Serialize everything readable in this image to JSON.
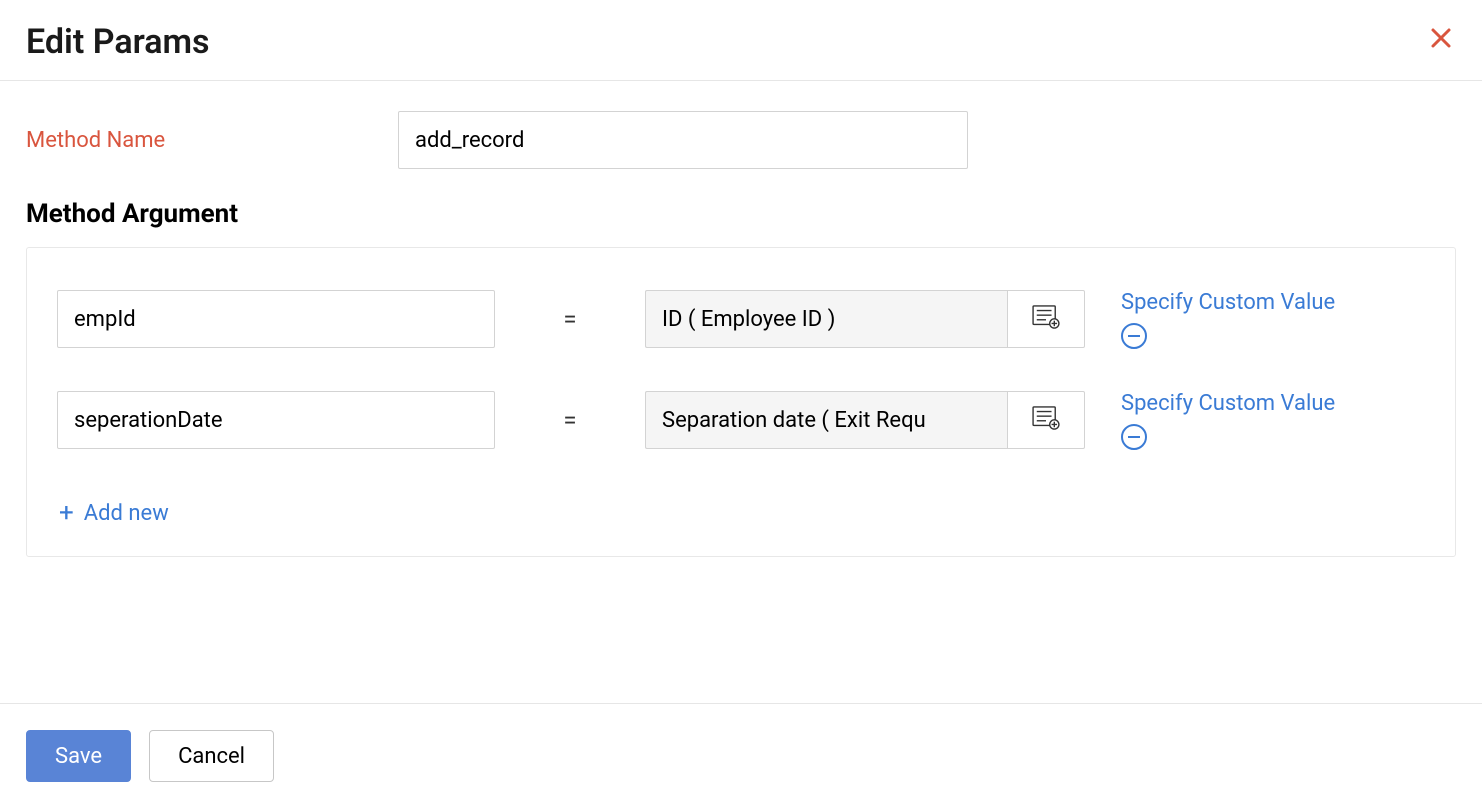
{
  "header": {
    "title": "Edit Params"
  },
  "method": {
    "label": "Method Name",
    "value": "add_record"
  },
  "args_heading": "Method Argument",
  "args": [
    {
      "key": "empId",
      "value": "ID ( Employee ID )",
      "custom_label": "Specify Custom Value"
    },
    {
      "key": "seperationDate",
      "value": "Separation date ( Exit Requ",
      "custom_label": "Specify Custom Value"
    }
  ],
  "add_new_label": "Add new",
  "footer": {
    "save": "Save",
    "cancel": "Cancel"
  }
}
